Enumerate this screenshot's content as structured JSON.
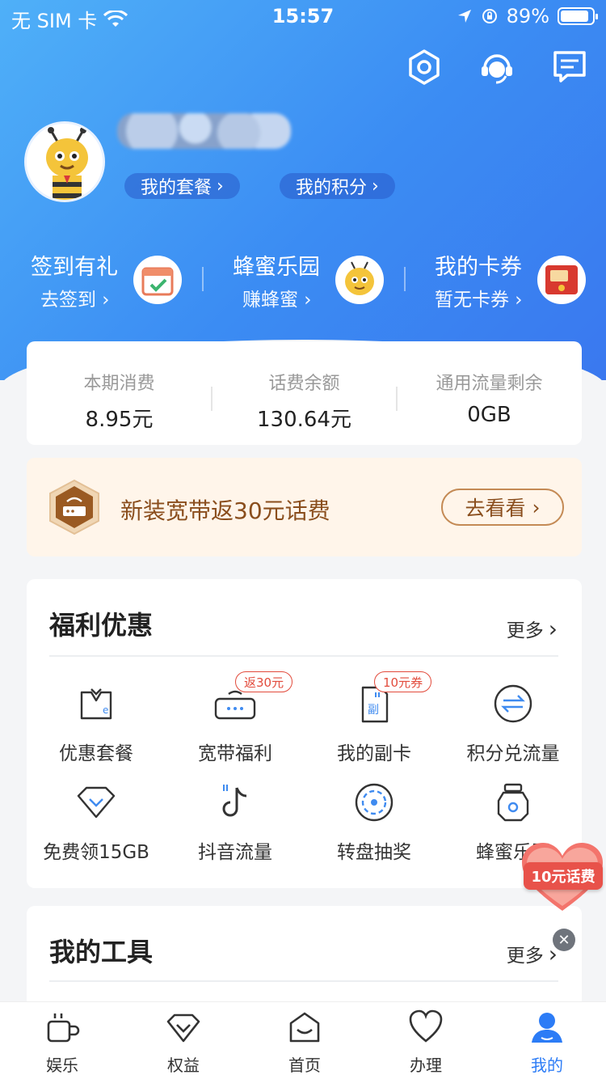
{
  "status_bar": {
    "carrier": "无 SIM 卡",
    "time": "15:57",
    "battery": "89%",
    "battery_level": 0.89
  },
  "header": {
    "package_label": "我的套餐",
    "points_label": "我的积分",
    "quick": [
      {
        "title": "签到有礼",
        "sub": "去签到"
      },
      {
        "title": "蜂蜜乐园",
        "sub": "赚蜂蜜"
      },
      {
        "title": "我的卡券",
        "sub": "暂无卡券"
      }
    ]
  },
  "stats": [
    {
      "label": "本期消费",
      "value": "8.95元"
    },
    {
      "label": "话费余额",
      "value": "130.64元"
    },
    {
      "label": "通用流量剩余",
      "value": "0GB"
    }
  ],
  "promo": {
    "text": "新装宽带返30元话费",
    "button": "去看看"
  },
  "benefits": {
    "title": "福利优惠",
    "more": "更多",
    "items": [
      {
        "label": "优惠套餐",
        "icon": "package-icon"
      },
      {
        "label": "宽带福利",
        "icon": "router-icon",
        "badge": "返30元"
      },
      {
        "label": "我的副卡",
        "icon": "sim-card-icon",
        "badge": "10元券"
      },
      {
        "label": "积分兑流量",
        "icon": "exchange-icon"
      },
      {
        "label": "免费领15GB",
        "icon": "diamond-icon"
      },
      {
        "label": "抖音流量",
        "icon": "tiktok-icon"
      },
      {
        "label": "转盘抽奖",
        "icon": "wheel-icon"
      },
      {
        "label": "蜂蜜乐园",
        "icon": "honey-jar-icon"
      }
    ]
  },
  "tools": {
    "title": "我的工具",
    "more": "更多"
  },
  "float_badge": "10元话费",
  "tabs": [
    {
      "label": "娱乐",
      "icon": "cup-icon"
    },
    {
      "label": "权益",
      "icon": "diamond-icon"
    },
    {
      "label": "首页",
      "icon": "home-icon"
    },
    {
      "label": "办理",
      "icon": "heart-icon"
    },
    {
      "label": "我的",
      "icon": "user-icon",
      "active": true
    }
  ],
  "colors": {
    "header_blue": "#3b8cf3",
    "active_tab": "#2c7cf6",
    "promo_brown": "#8a4e1d",
    "badge_red": "#e24b3c"
  }
}
